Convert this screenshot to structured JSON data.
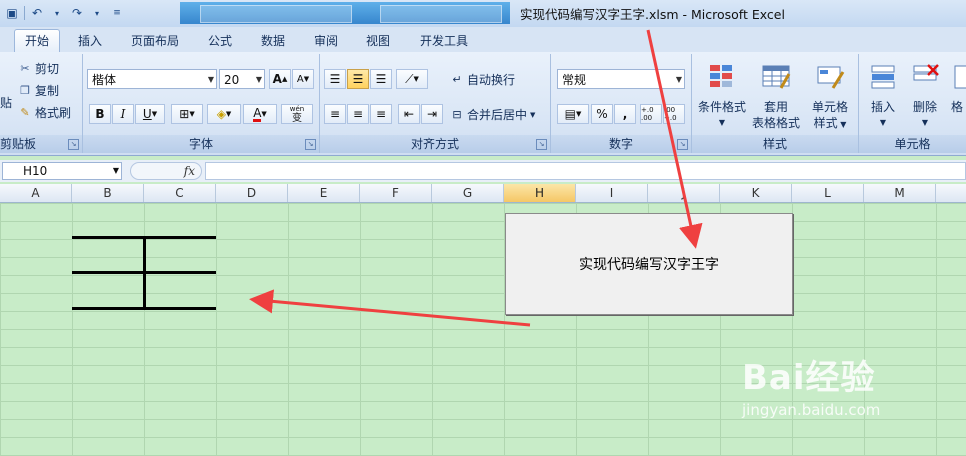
{
  "window": {
    "title": "实现代码编写汉字王字.xlsm - Microsoft Excel"
  },
  "ribbon_tabs": [
    "开始",
    "插入",
    "页面布局",
    "公式",
    "数据",
    "审阅",
    "视图",
    "开发工具"
  ],
  "clipboard": {
    "cut": "剪切",
    "copy": "复制",
    "format_painter": "格式刷",
    "paste_partial": "贴",
    "group_label": "剪贴板"
  },
  "font": {
    "name": "楷体",
    "size": "20",
    "grow": "A",
    "shrink": "A",
    "bold": "B",
    "italic": "I",
    "underline": "U",
    "font_color_letter": "A",
    "phonetic": "wén",
    "phonetic_char": "变",
    "group_label": "字体"
  },
  "alignment": {
    "wrap_text": "自动换行",
    "merge_center": "合并后居中",
    "group_label": "对齐方式"
  },
  "number": {
    "format": "常规",
    "percent": "%",
    "comma": ",",
    "inc_decimal": "+.0 .00",
    "dec_decimal": ".00 +.0",
    "group_label": "数字"
  },
  "styles": {
    "conditional_format": "条件格式",
    "format_table_1": "套用",
    "format_table_2": "表格格式",
    "cell_styles_1": "单元格",
    "cell_styles_2": "样式",
    "group_label": "样式"
  },
  "cells": {
    "insert": "插入",
    "delete": "删除",
    "format_partial": "格",
    "group_label": "单元格"
  },
  "formula_bar": {
    "name_box": "H10",
    "fx": "fx",
    "formula": ""
  },
  "columns": [
    "A",
    "B",
    "C",
    "D",
    "E",
    "F",
    "G",
    "H",
    "I",
    "J",
    "K",
    "L",
    "M"
  ],
  "selected_column": "H",
  "sheet_button": {
    "label": "实现代码编写汉字王字"
  },
  "watermark": {
    "brand": "Bai经验",
    "url": "jingyan.baidu.com"
  },
  "colors": {
    "arrow": "#ef4040",
    "sheet_bg": "#c8ecc8",
    "ribbon_bg": "#dbe7f6"
  }
}
